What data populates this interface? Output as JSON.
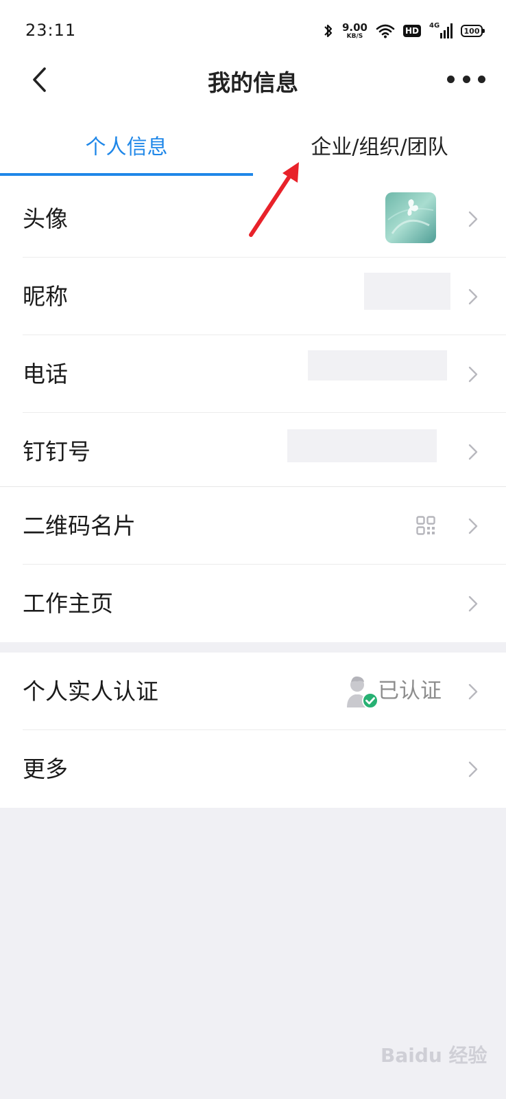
{
  "status_bar": {
    "time": "23:11",
    "net_speed_value": "9.00",
    "net_speed_unit": "KB/S",
    "hd_badge": "HD",
    "network_type": "4G",
    "battery_level": "100"
  },
  "header": {
    "title": "我的信息"
  },
  "tabs": [
    {
      "label": "个人信息",
      "active": true
    },
    {
      "label": "企业/组织/团队",
      "active": false
    }
  ],
  "rows": [
    {
      "label": "头像"
    },
    {
      "label": "昵称"
    },
    {
      "label": "电话"
    },
    {
      "label": "钉钉号"
    },
    {
      "label": "二维码名片"
    },
    {
      "label": "工作主页"
    },
    {
      "label": "个人实人认证",
      "value": "已认证"
    },
    {
      "label": "更多"
    }
  ],
  "colors": {
    "accent": "#1f87e8",
    "annotation_arrow": "#e8222a",
    "verified_check": "#27b173"
  },
  "watermark": "Baidu 经验"
}
